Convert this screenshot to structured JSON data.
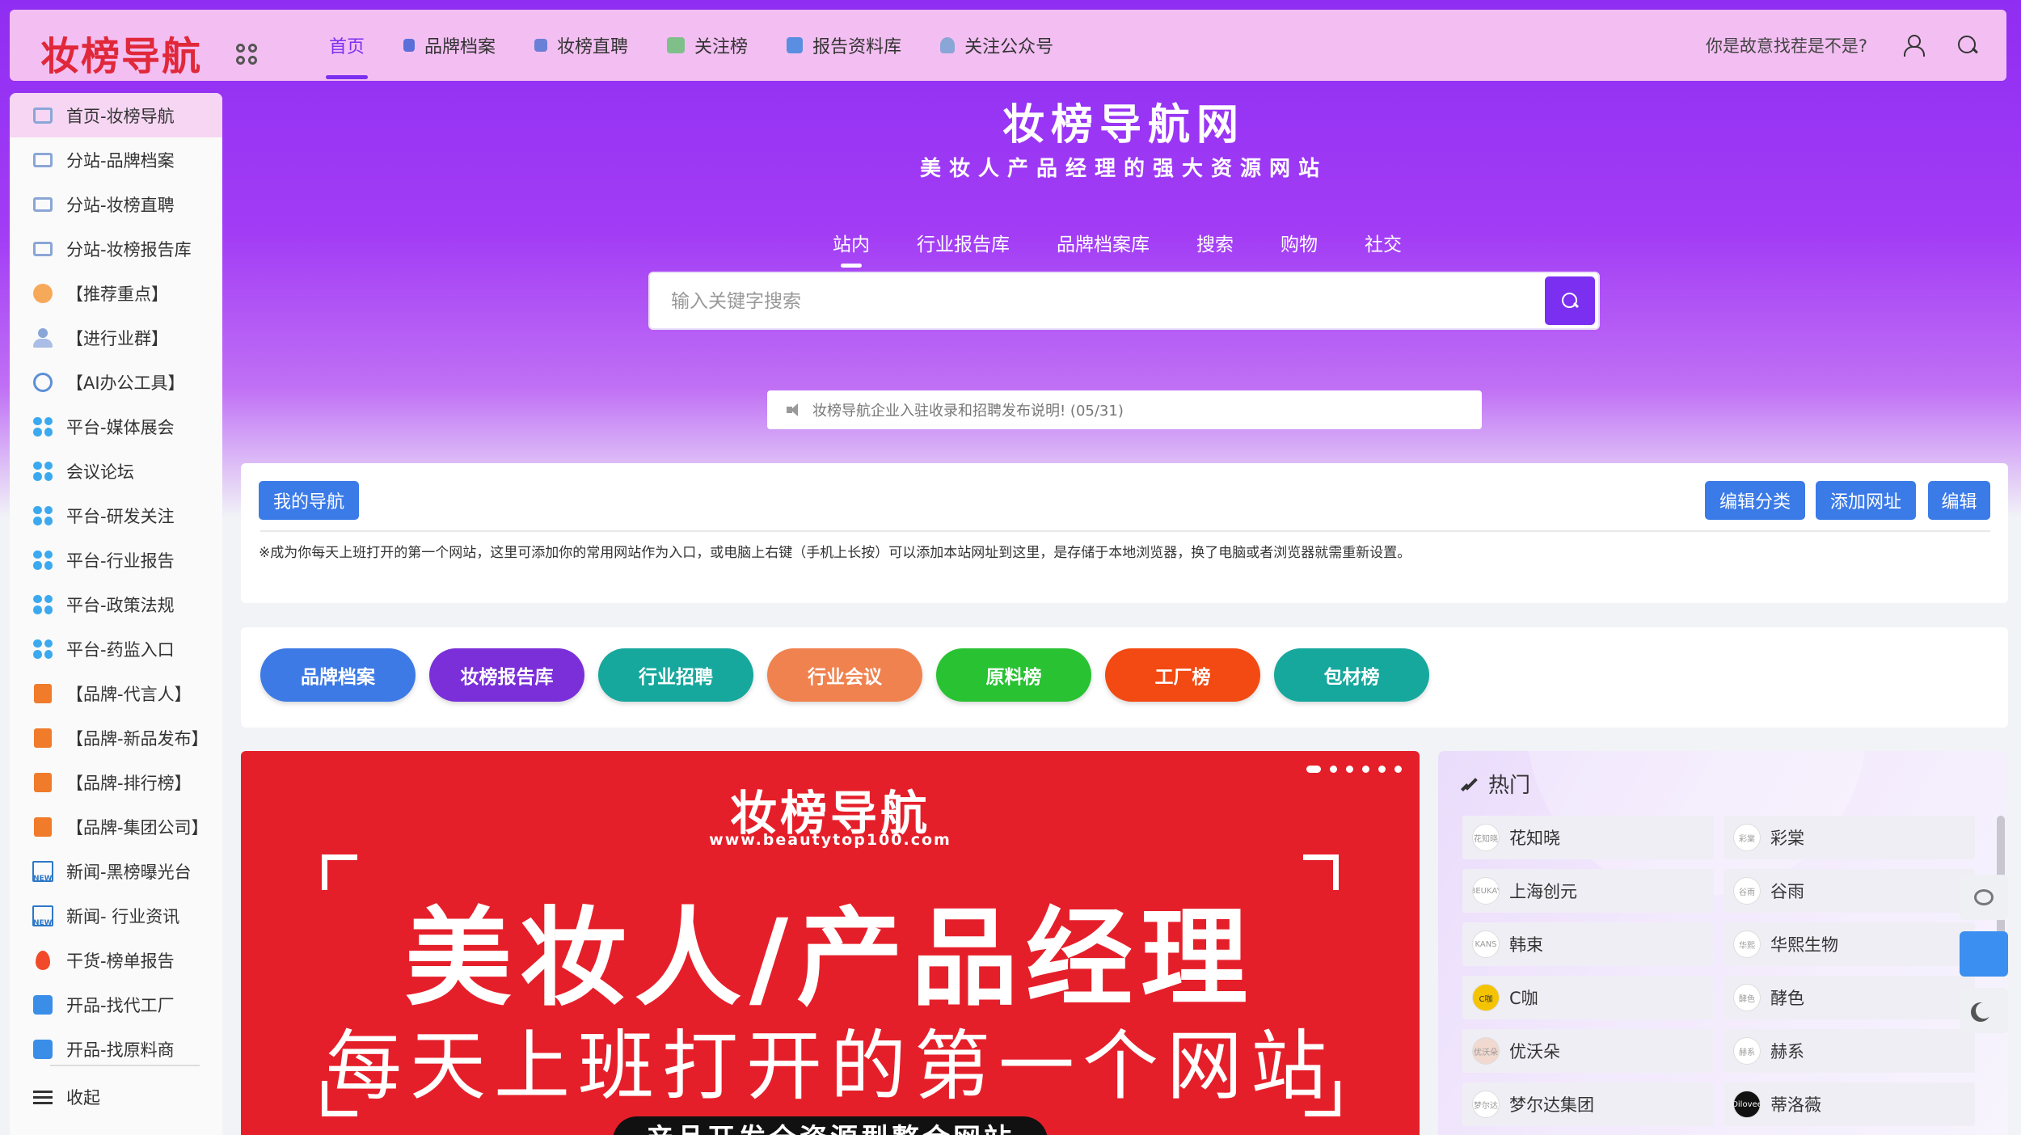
{
  "header": {
    "logo": "妆榜导航",
    "nav": [
      {
        "label": "首页",
        "color": "#7b2ff0"
      },
      {
        "label": "品牌档案",
        "color": "#5b6fd9"
      },
      {
        "label": "妆榜直聘",
        "color": "#6a7fd6"
      },
      {
        "label": "关注榜",
        "color": "#7fc08a"
      },
      {
        "label": "报告资料库",
        "color": "#5a8ee0"
      },
      {
        "label": "关注公众号",
        "color": "#8aa6d6"
      }
    ],
    "slogan": "你是故意找茬是不是?"
  },
  "sidebar": {
    "items": [
      {
        "label": "首页-妆榜导航",
        "icon": "home-icon"
      },
      {
        "label": "分站-品牌档案",
        "icon": "monitor-icon"
      },
      {
        "label": "分站-妆榜直聘",
        "icon": "monitor-icon"
      },
      {
        "label": "分站-妆榜报告库",
        "icon": "monitor-icon"
      },
      {
        "label": "【推荐重点】",
        "icon": "badge-icon"
      },
      {
        "label": "【进行业群】",
        "icon": "user-icon"
      },
      {
        "label": "【AI办公工具】",
        "icon": "at-icon"
      },
      {
        "label": "平台-媒体展会",
        "icon": "four-dots-icon"
      },
      {
        "label": "会议论坛",
        "icon": "four-dots-icon"
      },
      {
        "label": "平台-研发关注",
        "icon": "four-dots-icon"
      },
      {
        "label": "平台-行业报告",
        "icon": "four-dots-icon"
      },
      {
        "label": "平台-政策法规",
        "icon": "four-dots-icon"
      },
      {
        "label": "平台-药监入口",
        "icon": "four-dots-icon"
      },
      {
        "label": "【品牌-代言人】",
        "icon": "file-icon"
      },
      {
        "label": "【品牌-新品发布】",
        "icon": "file-icon"
      },
      {
        "label": "【品牌-排行榜】",
        "icon": "file-icon"
      },
      {
        "label": "【品牌-集团公司】",
        "icon": "file-icon"
      },
      {
        "label": "新闻-黑榜曝光台",
        "icon": "news-icon"
      },
      {
        "label": "新闻- 行业资讯",
        "icon": "news-icon"
      },
      {
        "label": "干货-榜单报告",
        "icon": "fire-icon"
      },
      {
        "label": "开品-找代工厂",
        "icon": "tool-icon"
      },
      {
        "label": "开品-找原料商",
        "icon": "tool-icon"
      }
    ],
    "collapse": "收起"
  },
  "hero": {
    "title": "妆榜导航网",
    "subtitle": "美妆人产品经理的强大资源网站",
    "tabs": [
      "站内",
      "行业报告库",
      "品牌档案库",
      "搜索",
      "购物",
      "社交"
    ],
    "search_placeholder": "输入关键字搜索",
    "notice": "妆榜导航企业入驻收录和招聘发布说明! (05/31)"
  },
  "mynav": {
    "title": "我的导航",
    "edit_category": "编辑分类",
    "add_url": "添加网址",
    "edit": "编辑",
    "tip": "※成为你每天上班打开的第一个网站，这里可添加你的常用网站作为入口，或电脑上右键（手机上长按）可以添加本站网址到这里，是存储于本地浏览器，换了电脑或者浏览器就需重新设置。"
  },
  "pills": [
    {
      "label": "品牌档案",
      "color": "#3d7ae6"
    },
    {
      "label": "妆榜报告库",
      "color": "#7a2fd8"
    },
    {
      "label": "行业招聘",
      "color": "#17a89d"
    },
    {
      "label": "行业会议",
      "color": "#f0824f"
    },
    {
      "label": "原料榜",
      "color": "#28c232"
    },
    {
      "label": "工厂榜",
      "color": "#f24a12"
    },
    {
      "label": "包材榜",
      "color": "#17a89d"
    }
  ],
  "banner": {
    "logo": "妆榜导航",
    "url": "www.beautytop100.com",
    "headline": "美妆人/产品经理",
    "subline": "每天上班打开的第一个网站",
    "pill": "产品开发全资源型整合网站"
  },
  "hot": {
    "title": "热门",
    "items": [
      {
        "name": "花知晓",
        "logo": "花知晓"
      },
      {
        "name": "彩棠",
        "logo": "彩棠"
      },
      {
        "name": "上海创元",
        "logo": "BEUKAY"
      },
      {
        "name": "谷雨",
        "logo": "谷雨"
      },
      {
        "name": "韩束",
        "logo": "KANS"
      },
      {
        "name": "华熙生物",
        "logo": "华熙"
      },
      {
        "name": "C咖",
        "logo": "C咖"
      },
      {
        "name": "酵色",
        "logo": "酵色"
      },
      {
        "name": "优沃朵",
        "logo": "优沃朵"
      },
      {
        "name": "赫系",
        "logo": "赫系"
      },
      {
        "name": "梦尔达集团",
        "logo": "梦尔达"
      },
      {
        "name": "蒂洛薇",
        "logo": "Dilovee"
      }
    ]
  },
  "colors": {
    "accent": "#7b2ff0",
    "header_bg": "#f3bff2",
    "banner_red": "#e51f2a",
    "logo_red": "#e0283a",
    "btn_blue": "#3b7be8"
  }
}
